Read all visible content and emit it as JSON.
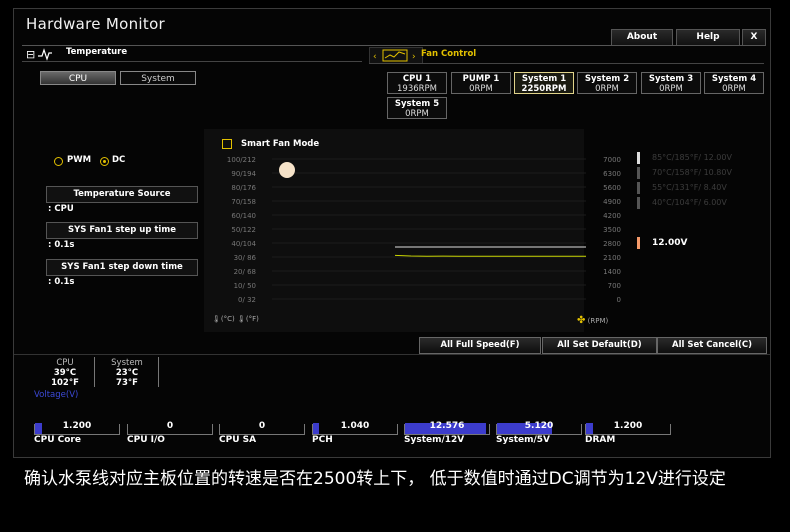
{
  "window": {
    "title": "Hardware Monitor",
    "buttons": [
      "About",
      "Help",
      "X"
    ]
  },
  "temperature": {
    "header": "Temperature",
    "tabs": [
      {
        "label": "CPU",
        "active": true
      },
      {
        "label": "System",
        "active": false
      }
    ],
    "mode": {
      "pwm": "PWM",
      "dc": "DC",
      "selected": "DC"
    },
    "source_btn": "Temperature Source",
    "source_val": ": CPU",
    "stepup_btn": "SYS Fan1 step up time",
    "stepup_val": ": 0.1s",
    "stepdown_btn": "SYS Fan1 step down time",
    "stepdown_val": ": 0.1s"
  },
  "fan_control": {
    "header": "Fan Control",
    "fans": [
      {
        "name": "CPU 1",
        "rpm": "1936RPM",
        "active": false
      },
      {
        "name": "PUMP 1",
        "rpm": "0RPM",
        "active": false
      },
      {
        "name": "System 1",
        "rpm": "2250RPM",
        "active": true
      },
      {
        "name": "System 2",
        "rpm": "0RPM",
        "active": false
      },
      {
        "name": "System 3",
        "rpm": "0RPM",
        "active": false
      },
      {
        "name": "System 4",
        "rpm": "0RPM",
        "active": false
      },
      {
        "name": "System 5",
        "rpm": "0RPM",
        "active": false
      }
    ]
  },
  "smart_fan": {
    "label": "Smart Fan Mode",
    "checked": false
  },
  "chart": {
    "temp_ticks": [
      "100/212",
      "90/194",
      "80/176",
      "70/158",
      "60/140",
      "50/122",
      "40/104",
      "30/ 86",
      "20/ 68",
      "10/ 50",
      "0/ 32"
    ],
    "rpm_ticks": [
      "7000",
      "6300",
      "5600",
      "4900",
      "4200",
      "3500",
      "2800",
      "2100",
      "1400",
      "700",
      "0"
    ],
    "temp_unit_c": "(°C)",
    "temp_unit_f": "(°F)",
    "rpm_unit": "(RPM)",
    "voltage_steps": [
      "85°C/185°F/  12.00V",
      "70°C/158°F/  10.80V",
      "55°C/131°F/  8.40V",
      "40°C/104°F/  6.00V"
    ],
    "current_voltage": "12.00V",
    "accent": "#e3c100",
    "marker_color": "#f5e2c8"
  },
  "chart_data": {
    "type": "line",
    "series": [
      {
        "values_rpm": [
          2180,
          2150,
          2140,
          2145,
          2138,
          2142,
          2135,
          2140,
          2137,
          2134,
          2139,
          2136,
          2133
        ]
      }
    ],
    "xlim_label": "time",
    "ylim_rpm": [
      0,
      7000
    ],
    "ylim_temp_c": [
      0,
      100
    ]
  },
  "actions": [
    "All Full Speed(F)",
    "All Set Default(D)",
    "All Set Cancel(C)"
  ],
  "stats": [
    {
      "name": "CPU",
      "c": "39°C",
      "f": "102°F"
    },
    {
      "name": "System",
      "c": "23°C",
      "f": "73°F"
    }
  ],
  "voltage_label": "Voltage(V)",
  "voltages": [
    {
      "name": "CPU Core",
      "value": "1.200",
      "fill": 0.08
    },
    {
      "name": "CPU I/O",
      "value": "0",
      "fill": 0
    },
    {
      "name": "CPU SA",
      "value": "0",
      "fill": 0
    },
    {
      "name": "PCH",
      "value": "1.040",
      "fill": 0.07
    },
    {
      "name": "System/12V",
      "value": "12.576",
      "fill": 0.97
    },
    {
      "name": "System/5V",
      "value": "5.120",
      "fill": 0.65
    },
    {
      "name": "DRAM",
      "value": "1.200",
      "fill": 0.08
    }
  ],
  "caption": "确认水泵线对应主板位置的转速是否在2500转上下， 低于数值时通过DC调节为12V进行设定"
}
